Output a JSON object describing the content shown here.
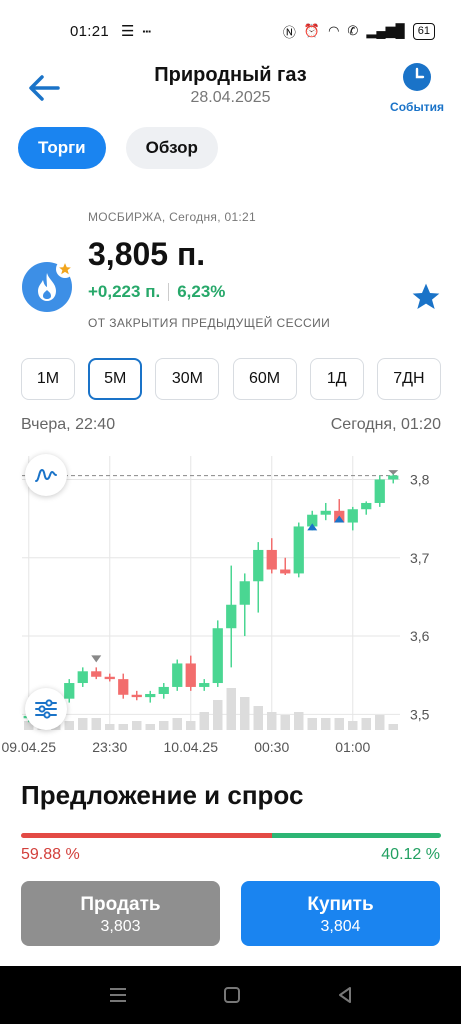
{
  "status_bar": {
    "time": "01:21",
    "battery": "61"
  },
  "header": {
    "title": "Природный газ",
    "date": "28.04.2025",
    "events_label": "События"
  },
  "tabs": [
    {
      "label": "Торги",
      "active": true
    },
    {
      "label": "Обзор",
      "active": false
    }
  ],
  "quote": {
    "exchange": "МОСБИРЖА, Сегодня, 01:21",
    "price": "3,805 п.",
    "change_abs": "+0,223 п.",
    "change_pct": "6,23%",
    "note": "ОТ ЗАКРЫТИЯ ПРЕДЫДУЩЕЙ СЕССИИ"
  },
  "periods": [
    {
      "label": "1М",
      "active": false
    },
    {
      "label": "5М",
      "active": true
    },
    {
      "label": "30М",
      "active": false
    },
    {
      "label": "60М",
      "active": false
    },
    {
      "label": "1Д",
      "active": false
    },
    {
      "label": "7ДН",
      "active": false
    }
  ],
  "range": {
    "start": "Вчера, 22:40",
    "end": "Сегодня, 01:20"
  },
  "chart_data": {
    "type": "candlestick",
    "y_ticks": [
      "3,8",
      "3,7",
      "3,6",
      "3,5"
    ],
    "y_tick_values": [
      3.8,
      3.7,
      3.6,
      3.5
    ],
    "ylim": [
      3.48,
      3.83
    ],
    "x_labels": [
      "09.04.25",
      "23:30",
      "10.04.25",
      "00:30",
      "01:00"
    ],
    "x_label_index": [
      0,
      6,
      12,
      18,
      24
    ],
    "last_price_line": 3.805,
    "candles": [
      {
        "o": 3.495,
        "h": 3.505,
        "l": 3.49,
        "c": 3.498
      },
      {
        "o": 3.498,
        "h": 3.515,
        "l": 3.495,
        "c": 3.51
      },
      {
        "o": 3.51,
        "h": 3.525,
        "l": 3.505,
        "c": 3.52
      },
      {
        "o": 3.52,
        "h": 3.545,
        "l": 3.515,
        "c": 3.54
      },
      {
        "o": 3.54,
        "h": 3.56,
        "l": 3.535,
        "c": 3.555
      },
      {
        "o": 3.555,
        "h": 3.56,
        "l": 3.545,
        "c": 3.548
      },
      {
        "o": 3.548,
        "h": 3.552,
        "l": 3.542,
        "c": 3.545
      },
      {
        "o": 3.545,
        "h": 3.552,
        "l": 3.52,
        "c": 3.525
      },
      {
        "o": 3.525,
        "h": 3.53,
        "l": 3.518,
        "c": 3.522
      },
      {
        "o": 3.522,
        "h": 3.53,
        "l": 3.515,
        "c": 3.526
      },
      {
        "o": 3.526,
        "h": 3.54,
        "l": 3.52,
        "c": 3.535
      },
      {
        "o": 3.535,
        "h": 3.57,
        "l": 3.53,
        "c": 3.565
      },
      {
        "o": 3.565,
        "h": 3.575,
        "l": 3.53,
        "c": 3.535
      },
      {
        "o": 3.535,
        "h": 3.545,
        "l": 3.53,
        "c": 3.54
      },
      {
        "o": 3.54,
        "h": 3.62,
        "l": 3.535,
        "c": 3.61
      },
      {
        "o": 3.61,
        "h": 3.69,
        "l": 3.56,
        "c": 3.64
      },
      {
        "o": 3.64,
        "h": 3.68,
        "l": 3.6,
        "c": 3.67
      },
      {
        "o": 3.67,
        "h": 3.72,
        "l": 3.63,
        "c": 3.71
      },
      {
        "o": 3.71,
        "h": 3.725,
        "l": 3.68,
        "c": 3.685
      },
      {
        "o": 3.685,
        "h": 3.7,
        "l": 3.678,
        "c": 3.68
      },
      {
        "o": 3.68,
        "h": 3.745,
        "l": 3.675,
        "c": 3.74
      },
      {
        "o": 3.74,
        "h": 3.76,
        "l": 3.735,
        "c": 3.755
      },
      {
        "o": 3.755,
        "h": 3.77,
        "l": 3.748,
        "c": 3.76
      },
      {
        "o": 3.76,
        "h": 3.775,
        "l": 3.75,
        "c": 3.745
      },
      {
        "o": 3.745,
        "h": 3.765,
        "l": 3.735,
        "c": 3.762
      },
      {
        "o": 3.762,
        "h": 3.772,
        "l": 3.755,
        "c": 3.77
      },
      {
        "o": 3.77,
        "h": 3.805,
        "l": 3.765,
        "c": 3.8
      },
      {
        "o": 3.8,
        "h": 3.81,
        "l": 3.795,
        "c": 3.805
      }
    ],
    "volume": [
      0.15,
      0.2,
      0.15,
      0.15,
      0.2,
      0.2,
      0.1,
      0.1,
      0.15,
      0.1,
      0.15,
      0.2,
      0.15,
      0.3,
      0.5,
      0.7,
      0.55,
      0.4,
      0.3,
      0.25,
      0.3,
      0.2,
      0.2,
      0.2,
      0.15,
      0.2,
      0.25,
      0.1
    ],
    "colors": {
      "up": "#4ad692",
      "down": "#f26d6d",
      "volume": "#dcdcdc",
      "grid": "#e6e6e6",
      "marker_up": "#1a73c8",
      "marker_down": "#888888"
    }
  },
  "orderbook": {
    "title": "Предложение и спрос",
    "sell_pct": "59.88 %",
    "buy_pct": "40.12 %",
    "sell_fraction": 0.5988
  },
  "actions": {
    "sell": {
      "label": "Продать",
      "price": "3,803"
    },
    "buy": {
      "label": "Купить",
      "price": "3,804"
    }
  }
}
